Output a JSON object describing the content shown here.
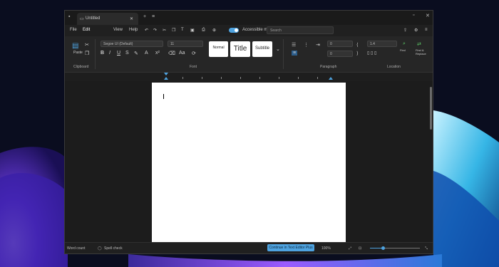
{
  "tab": {
    "title": "Untitled"
  },
  "menu": {
    "items": [
      "File",
      "Edit",
      "View",
      "Help"
    ],
    "toggle_label": "Accessible mode",
    "search_placeholder": "Search"
  },
  "ribbon": {
    "font_name": "Segoe UI (Default)",
    "font_size": "11",
    "styles": [
      "Normal",
      "Title",
      "Subtitle"
    ],
    "group_clipboard": "Clipboard",
    "group_font": "Font",
    "group_paragraph": "Paragraph",
    "group_location": "Location",
    "spacing_before": "0",
    "spacing_after": "0",
    "line_spacing": "1.4",
    "find_label": "Find",
    "replace_label": "Find & Replace",
    "paste_label": "Paste"
  },
  "status": {
    "word_count": "Word count",
    "spell_check": "Spell check",
    "continue_button": "Continue in Text Editor Plus",
    "zoom": "100%",
    "zoom_level": 0.25
  },
  "icons": [
    "app-icon",
    "close-icon",
    "new-tab-icon",
    "more-icon",
    "undo-icon",
    "redo-icon",
    "bold-icon",
    "italic-icon",
    "underline-icon",
    "paste-icon",
    "find-icon",
    "replace-icon",
    "minimize-icon",
    "maximize-icon",
    "window-close-icon"
  ]
}
